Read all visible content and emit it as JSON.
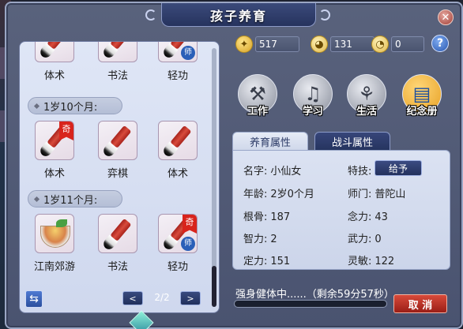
{
  "window": {
    "title": "孩子养育"
  },
  "currencies": [
    {
      "icon": "gold-coin-icon",
      "value": "517"
    },
    {
      "icon": "smile-face-coin-icon",
      "value": "131"
    },
    {
      "icon": "content-face-coin-icon",
      "value": "0"
    }
  ],
  "help_label": "?",
  "actions": [
    {
      "name": "work-action",
      "label": "工作",
      "icon": "anvil-icon"
    },
    {
      "name": "study-action",
      "label": "学习",
      "icon": "guitar-icon"
    },
    {
      "name": "life-action",
      "label": "生活",
      "icon": "utensils-icon"
    },
    {
      "name": "album-action",
      "label": "纪念册",
      "icon": "album-icon"
    }
  ],
  "tabs": {
    "nurture": "养育属性",
    "combat": "战斗属性"
  },
  "attributes": {
    "name_k": "名字:",
    "name_v": "小仙女",
    "skill_k": "特技:",
    "age_k": "年龄:",
    "age_v": "2岁0个月",
    "sect_k": "师门:",
    "sect_v": "普陀山",
    "bone_k": "根骨:",
    "bone_v": "187",
    "mind_k": "念力:",
    "mind_v": "43",
    "int_k": "智力:",
    "int_v": "2",
    "force_k": "武力:",
    "force_v": "0",
    "focus_k": "定力:",
    "focus_v": "151",
    "agility_k": "灵敏:",
    "agility_v": "122"
  },
  "give_label": "给予",
  "status": {
    "text": "强身健体中......（剩余59分57秒）",
    "progress": 0.0
  },
  "cancel_label": "取 消",
  "schedule": {
    "top_row": [
      "体术",
      "书法",
      "轻功"
    ],
    "group1": {
      "title": "1岁10个月:",
      "items": [
        "体术",
        "弈棋",
        "体术"
      ]
    },
    "group2": {
      "title": "1岁11个月:",
      "items": [
        "江南郊游",
        "书法",
        "轻功"
      ]
    }
  },
  "badges": {
    "rare": "奇",
    "master": "师"
  },
  "pager": {
    "prev": "<",
    "next": ">",
    "page": "2/2"
  },
  "refresh_icon": "⇆"
}
